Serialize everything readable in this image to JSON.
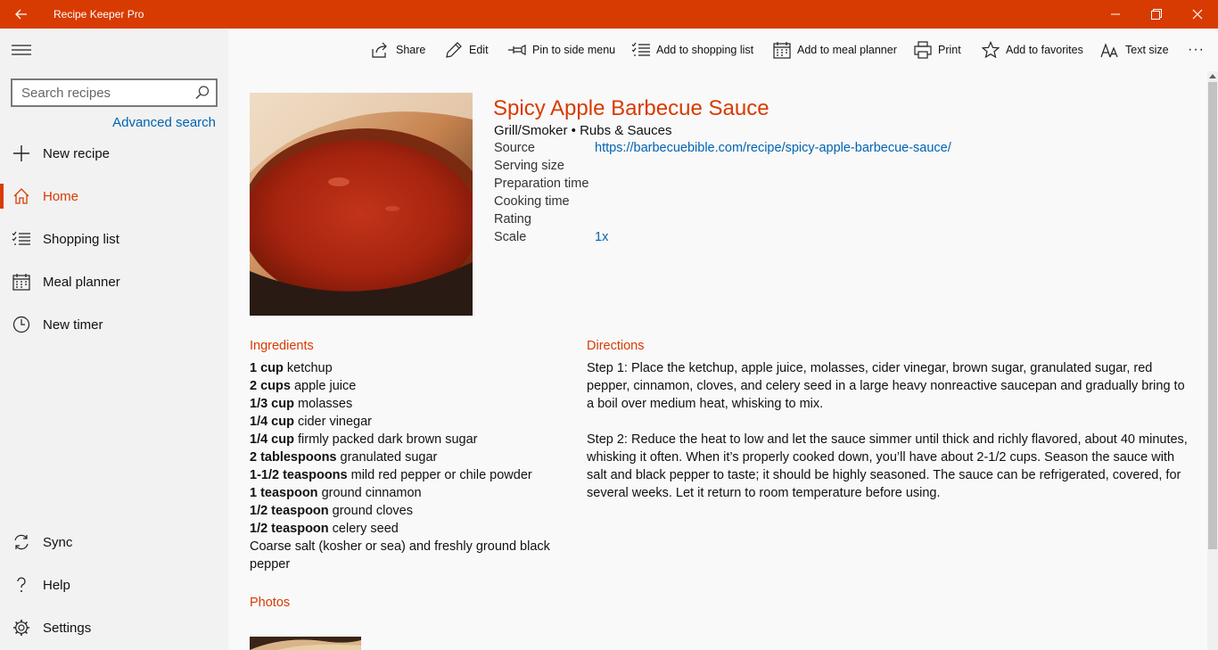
{
  "window": {
    "title": "Recipe Keeper Pro",
    "accent": "#d83b01"
  },
  "sidebar": {
    "search_placeholder": "Search recipes",
    "advanced_search": "Advanced search",
    "nav": [
      {
        "label": "New recipe",
        "icon": "plus-icon"
      },
      {
        "label": "Home",
        "icon": "home-icon",
        "active": true
      },
      {
        "label": "Shopping list",
        "icon": "shopping-list-icon"
      },
      {
        "label": "Meal planner",
        "icon": "calendar-icon"
      },
      {
        "label": "New timer",
        "icon": "clock-icon"
      }
    ],
    "bottom": [
      {
        "label": "Sync",
        "icon": "sync-icon"
      },
      {
        "label": "Help",
        "icon": "help-icon"
      },
      {
        "label": "Settings",
        "icon": "gear-icon"
      }
    ]
  },
  "toolbar": {
    "share": "Share",
    "edit": "Edit",
    "pin": "Pin to side menu",
    "shopping": "Add to shopping list",
    "meal": "Add to meal planner",
    "print": "Print",
    "favorites": "Add to favorites",
    "text_size": "Text size",
    "more": "···"
  },
  "recipe": {
    "title": "Spicy Apple Barbecue Sauce",
    "categories": "Grill/Smoker • Rubs & Sauces",
    "meta": {
      "source_label": "Source",
      "source_value": "https://barbecuebible.com/recipe/spicy-apple-barbecue-sauce/",
      "serving_label": "Serving size",
      "prep_label": "Preparation time",
      "cooking_label": "Cooking time",
      "rating_label": "Rating",
      "scale_label": "Scale",
      "scale_value": "1x"
    },
    "ingredients_heading": "Ingredients",
    "ingredients": [
      {
        "qty": "1 cup",
        "item": " ketchup"
      },
      {
        "qty": "2 cups",
        "item": " apple juice"
      },
      {
        "qty": "1/3 cup",
        "item": " molasses"
      },
      {
        "qty": "1/4 cup",
        "item": " cider vinegar"
      },
      {
        "qty": "1/4 cup",
        "item": " firmly packed dark brown sugar"
      },
      {
        "qty": "2 tablespoons",
        "item": " granulated sugar"
      },
      {
        "qty": "1-1/2 teaspoons",
        "item": " mild red pepper or chile powder"
      },
      {
        "qty": "1 teaspoon",
        "item": " ground cinnamon"
      },
      {
        "qty": "1/2 teaspoon",
        "item": " ground cloves"
      },
      {
        "qty": "1/2 teaspoon",
        "item": " celery seed"
      },
      {
        "qty": "",
        "item": "Coarse salt (kosher or sea) and freshly ground black pepper"
      }
    ],
    "directions_heading": "Directions",
    "directions": [
      "Step 1: Place the ketchup, apple juice, molasses, cider vinegar, brown sugar, granulated sugar, red pepper, cinnamon, cloves, and celery seed in a large heavy nonreactive saucepan and gradually bring to a boil over medium heat, whisking to mix.",
      "Step 2: Reduce the heat to low and let the sauce simmer until thick and richly flavored, about 40 minutes, whisking it often. When it’s properly cooked down, you’ll have about 2-1/2 cups. Season the sauce with salt and black pepper to taste; it should be highly seasoned. The sauce can be refrigerated, covered, for several weeks. Let it return to room temperature before using."
    ],
    "photos_heading": "Photos"
  }
}
